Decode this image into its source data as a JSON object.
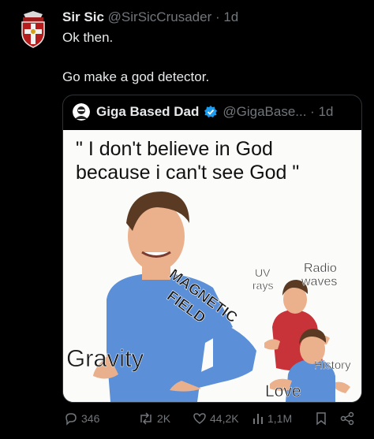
{
  "post": {
    "author_name": "Sir Sic",
    "author_meta": "@SirSicCrusader · 1d",
    "line1": "Ok then.",
    "line2": "Go make a god detector."
  },
  "quoted_post": {
    "author_name": "Giga Based Dad",
    "author_meta": "@GigaBase... · 1d"
  },
  "meme": {
    "caption_line1": "\" I don't believe in God",
    "caption_line2": "because i can't see God \"",
    "labels": {
      "uv": [
        "UV",
        "rays"
      ],
      "radio": [
        "Radio",
        "waves"
      ],
      "magnetic": [
        "MAGNETIC",
        "FIELD"
      ],
      "gravity": "Gravity",
      "history": "History",
      "love": "Love"
    }
  },
  "actions": {
    "replies": "346",
    "reposts": "2K",
    "likes": "44,2K",
    "views": "1,1M"
  },
  "icons": [
    "crest-avatar-icon",
    "dad-avatar-icon",
    "verified-badge-icon",
    "reply-icon",
    "repost-icon",
    "like-icon",
    "views-icon",
    "bookmark-icon",
    "share-icon"
  ],
  "colors": {
    "background": "#000000",
    "text": "#e7e9ea",
    "muted": "#71767b",
    "verified": "#1d9bf0"
  }
}
